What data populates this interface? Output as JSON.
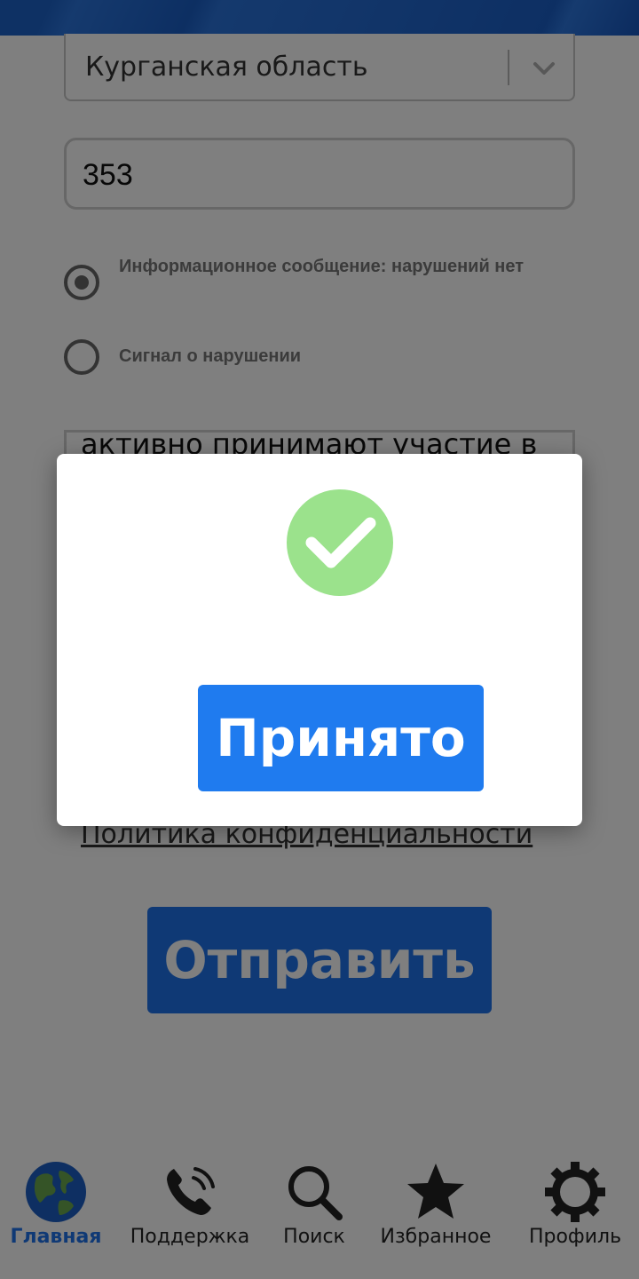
{
  "form": {
    "region_value": "Курганская область",
    "code_value": "353",
    "radio_options": [
      {
        "label": "Информационное сообщение: нарушений нет",
        "selected": true
      },
      {
        "label": "Сигнал о нарушении",
        "selected": false
      }
    ],
    "textarea_value": "активно принимают участие в",
    "privacy_link": "Политика конфиденциальности",
    "submit_label": "Отправить"
  },
  "modal": {
    "icon": "check-circle-icon",
    "accept_label": "Принято"
  },
  "tabbar": {
    "items": [
      {
        "label": "Главная",
        "icon": "globe-icon",
        "active": true
      },
      {
        "label": "Поддержка",
        "icon": "phone-icon",
        "active": false
      },
      {
        "label": "Поиск",
        "icon": "search-icon",
        "active": false
      },
      {
        "label": "Избранное",
        "icon": "star-icon",
        "active": false
      },
      {
        "label": "Профиль",
        "icon": "gear-icon",
        "active": false
      }
    ]
  },
  "colors": {
    "primary": "#1f72ea",
    "success": "#9be28c",
    "overlay": "rgba(0,0,0,0.5)"
  }
}
